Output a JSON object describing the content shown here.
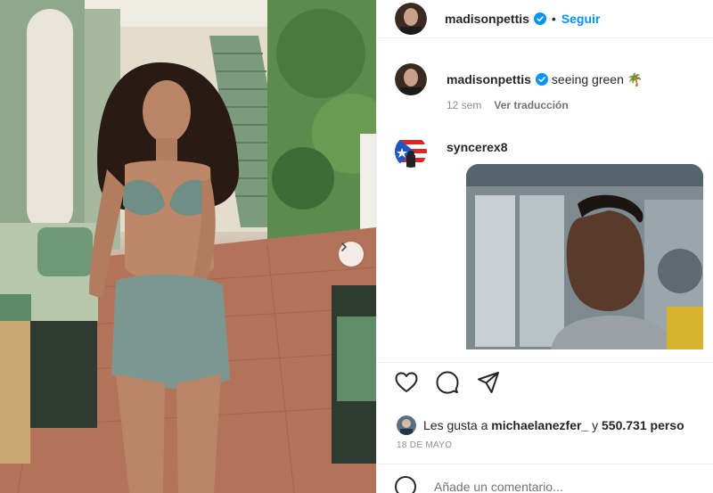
{
  "post": {
    "username": "madisonpettis",
    "follow_label": "Seguir",
    "separator": "•",
    "caption": "seeing green 🌴",
    "age": "12 sem",
    "translate_label": "Ver traducción"
  },
  "comment": {
    "username": "syncerex8"
  },
  "likes": {
    "prefix": "Les gusta a",
    "user": "michaelanezfer_",
    "middle": "y",
    "count": "550.731",
    "suffix": "perso"
  },
  "date": "18 DE MAYO",
  "add_comment": {
    "placeholder": "Añade un comentario..."
  },
  "colors": {
    "accent": "#0095f6",
    "verified": "#0095f6",
    "text": "#262626",
    "muted": "#8e8e8e"
  },
  "icons": [
    "chevron-right-icon",
    "verified-icon",
    "heart-icon",
    "comment-icon",
    "share-icon",
    "emoji-icon",
    "palm-tree-icon"
  ]
}
